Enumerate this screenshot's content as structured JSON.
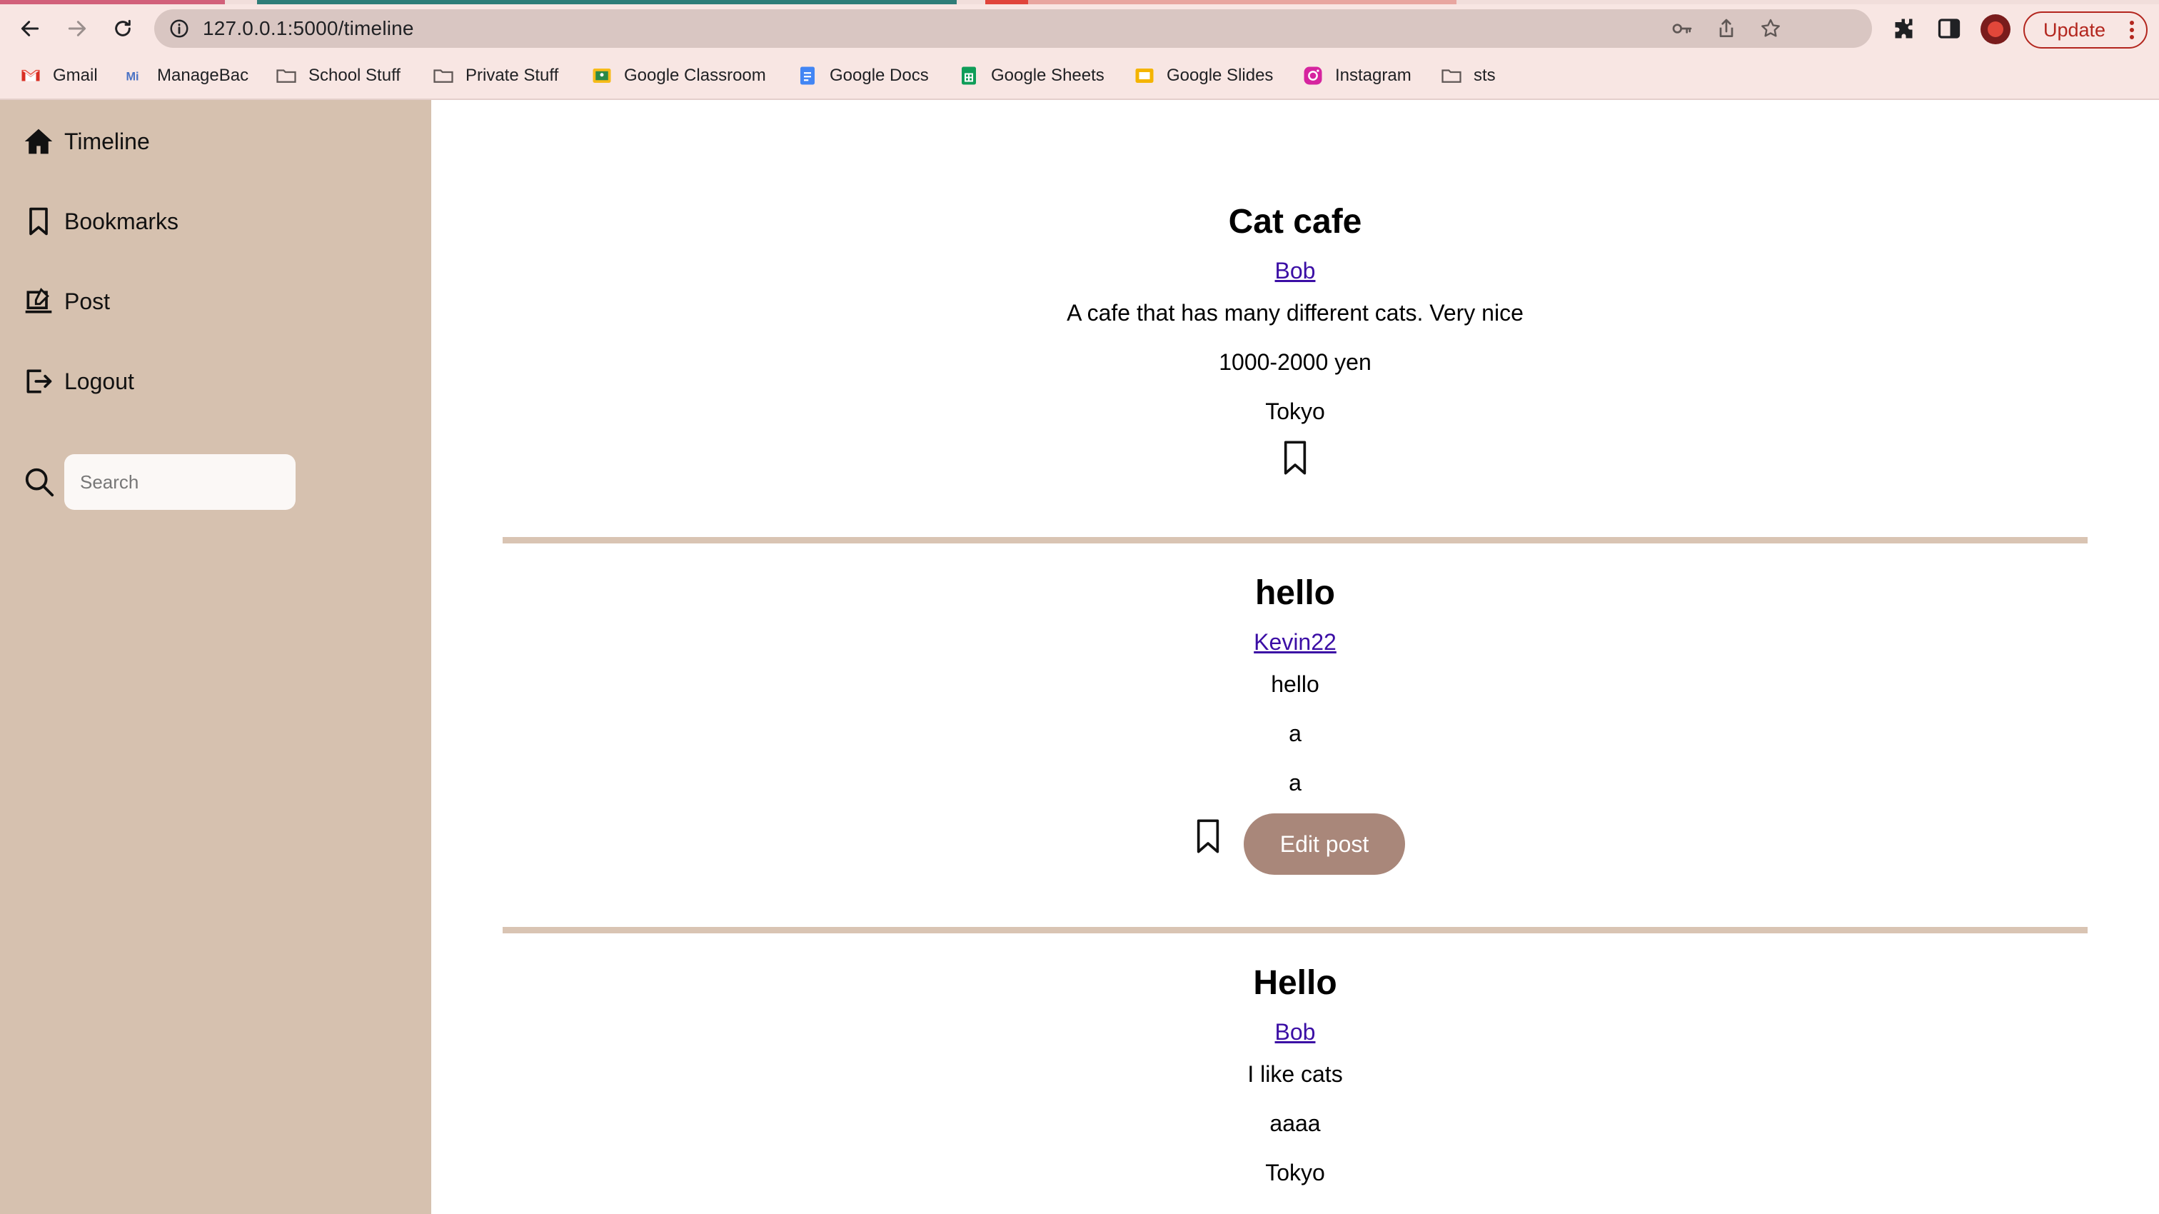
{
  "browser": {
    "url": "127.0.0.1:5000/timeline",
    "update_label": "Update",
    "bookmarks": [
      {
        "label": "Gmail",
        "icon": "gmail-icon"
      },
      {
        "label": "ManageBac",
        "icon": "managebac-icon"
      },
      {
        "label": "School Stuff",
        "icon": "folder-icon"
      },
      {
        "label": "Private Stuff",
        "icon": "folder-icon"
      },
      {
        "label": "Google Classroom",
        "icon": "google-classroom-icon"
      },
      {
        "label": "Google Docs",
        "icon": "google-docs-icon"
      },
      {
        "label": "Google Sheets",
        "icon": "google-sheets-icon"
      },
      {
        "label": "Google Slides",
        "icon": "google-slides-icon"
      },
      {
        "label": "Instagram",
        "icon": "instagram-icon"
      },
      {
        "label": "sts",
        "icon": "folder-icon"
      }
    ]
  },
  "sidebar": {
    "items": [
      {
        "label": "Timeline",
        "icon": "home-icon"
      },
      {
        "label": "Bookmarks",
        "icon": "bookmark-icon"
      },
      {
        "label": "Post",
        "icon": "compose-icon"
      },
      {
        "label": "Logout",
        "icon": "logout-icon"
      }
    ],
    "search_placeholder": "Search"
  },
  "posts": [
    {
      "title": "Cat cafe",
      "author": "Bob",
      "description": "A cafe that has many different cats. Very nice",
      "price": "1000-2000 yen",
      "location": "Tokyo",
      "editable": false
    },
    {
      "title": "hello",
      "author": "Kevin22",
      "description": "hello",
      "price": "a",
      "location": "a",
      "editable": true,
      "edit_label": "Edit post"
    },
    {
      "title": "Hello",
      "author": "Bob",
      "description": "I like cats",
      "price": "aaaa",
      "location": "Tokyo",
      "editable": false
    }
  ],
  "colors": {
    "sidebar_bg": "#d6c1af",
    "divider": "#d9c4b3",
    "edit_button": "#a9877a",
    "author_link": "#3b0ea5",
    "browser_toolbar": "#f8e6e3"
  }
}
